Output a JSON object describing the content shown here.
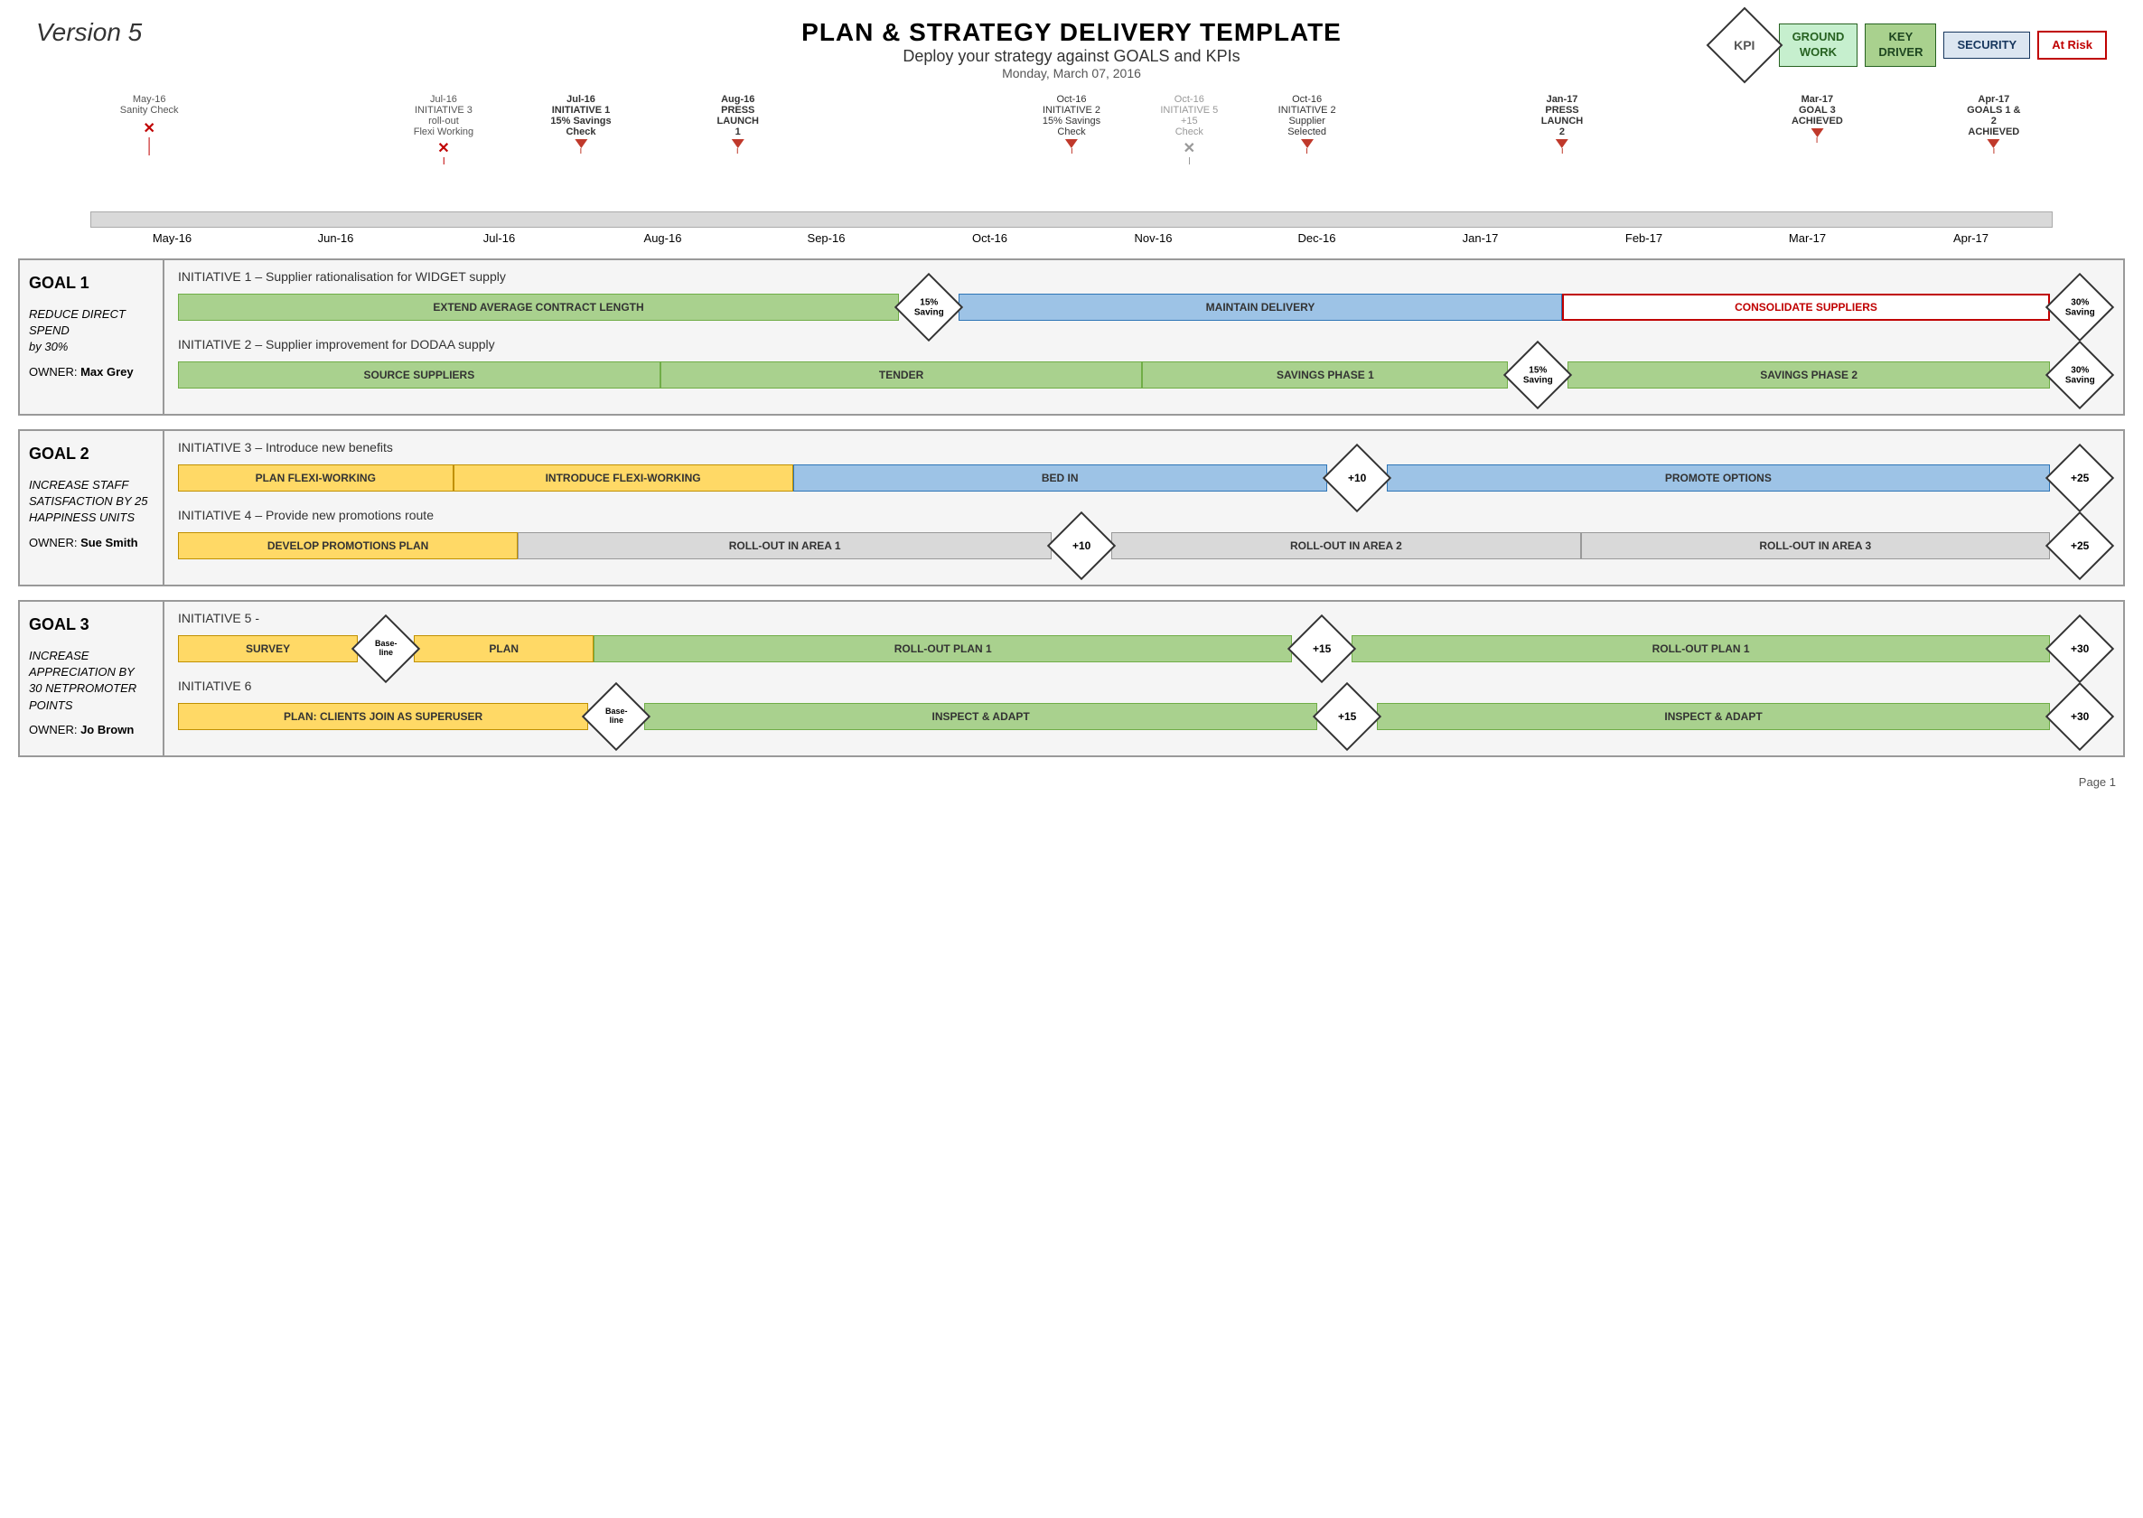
{
  "header": {
    "title": "PLAN & STRATEGY DELIVERY TEMPLATE",
    "subtitle": "Deploy your strategy against GOALS and KPIs",
    "date": "Monday, March 07, 2016",
    "version": "Version 5",
    "kpi_label": "KPI",
    "legend": [
      {
        "label": "GROUND\nWORK",
        "class": "legend-groundwork"
      },
      {
        "label": "KEY\nDRIVER",
        "class": "legend-keydriver"
      },
      {
        "label": "SECURITY",
        "class": "legend-security"
      },
      {
        "label": "At Risk",
        "class": "legend-atrisk"
      }
    ]
  },
  "timeline": {
    "months": [
      "May-16",
      "Jun-16",
      "Jul-16",
      "Aug-16",
      "Sep-16",
      "Oct-16",
      "Nov-16",
      "Dec-16",
      "Jan-17",
      "Feb-17",
      "Mar-17",
      "Apr-17"
    ],
    "events": [
      {
        "label": "May-16\nSanity Check",
        "pos_pct": 4,
        "type": "x"
      },
      {
        "label": "Jul-16\nINITIATIVE 3\nroll-out\nFlexi Working",
        "pos_pct": 19,
        "type": "x"
      },
      {
        "label": "Jul-16\nINITIATIVE 1\n15% Savings\nCheck",
        "pos_pct": 24,
        "type": "arrow",
        "bold": true
      },
      {
        "label": "Aug-16\nPRESS\nLAUNCH\n1",
        "pos_pct": 33,
        "type": "arrow",
        "bold": true
      },
      {
        "label": "Oct-16\nINITIATIVE 2\n15% Savings\nCheck",
        "pos_pct": 50,
        "type": "arrow",
        "bold": false
      },
      {
        "label": "Oct-16\nINITIATIVE 5\n+15\nCheck",
        "pos_pct": 55,
        "type": "x",
        "gray": true
      },
      {
        "label": "Oct-16\nINITIATIVE 2\nSupplier\nSelected",
        "pos_pct": 61,
        "type": "arrow"
      },
      {
        "label": "Jan-17\nPRESS\nLAUNCH\n2",
        "pos_pct": 75,
        "type": "arrow",
        "bold": true
      },
      {
        "label": "Mar-17\nGOAL 3\nACHIEVED",
        "pos_pct": 88,
        "type": "arrow",
        "bold": true
      },
      {
        "label": "Apr-17\nGOALS 1 & 2\nACHIEVED",
        "pos_pct": 97,
        "type": "arrow",
        "bold": true
      }
    ]
  },
  "goals": [
    {
      "id": "goal1",
      "title": "GOAL 1",
      "description": "REDUCE DIRECT\nSPEND\nby 30%",
      "owner_label": "OWNER:",
      "owner_name": "Max Grey",
      "initiatives": [
        {
          "title": "INITIATIVE 1 – Supplier rationalisation for WIDGET supply",
          "bars": [
            {
              "label": "EXTEND AVERAGE CONTRACT LENGTH",
              "class": "bar-green",
              "flex": 6
            },
            {
              "diamond": true,
              "label": "15%\nSaving"
            },
            {
              "label": "MAINTAIN DELIVERY",
              "class": "bar-blue",
              "flex": 5
            },
            {
              "label": "CONSOLIDATE SUPPLIERS",
              "class": "bar-red-border",
              "flex": 4
            },
            {
              "diamond": true,
              "label": "30%\nSaving"
            }
          ]
        },
        {
          "title": "INITIATIVE 2 – Supplier improvement for DODAA supply",
          "bars": [
            {
              "label": "SOURCE SUPPLIERS",
              "class": "bar-green",
              "flex": 4
            },
            {
              "label": "TENDER",
              "class": "bar-green",
              "flex": 4
            },
            {
              "label": "SAVINGS PHASE 1",
              "class": "bar-green",
              "flex": 3
            },
            {
              "diamond": true,
              "label": "15%\nSaving"
            },
            {
              "label": "SAVINGS PHASE 2",
              "class": "bar-green",
              "flex": 4
            },
            {
              "diamond": true,
              "label": "30%\nSaving"
            }
          ]
        }
      ]
    },
    {
      "id": "goal2",
      "title": "GOAL 2",
      "description": "INCREASE STAFF\nSATISFACTION BY 25\nHAPPINESS UNITS",
      "owner_label": "OWNER:",
      "owner_name": "Sue Smith",
      "initiatives": [
        {
          "title": "INITIATIVE 3 – Introduce new benefits",
          "bars": [
            {
              "label": "PLAN FLEXI-WORKING",
              "class": "bar-yellow",
              "flex": 2
            },
            {
              "label": "INTRODUCE FLEXI-WORKING",
              "class": "bar-yellow",
              "flex": 2.5
            },
            {
              "label": "BED IN",
              "class": "bar-blue",
              "flex": 4
            },
            {
              "diamond": true,
              "label": "+10"
            },
            {
              "label": "PROMOTE OPTIONS",
              "class": "bar-blue",
              "flex": 5
            },
            {
              "diamond": true,
              "label": "+25"
            }
          ]
        },
        {
          "title": "INITIATIVE 4 – Provide new promotions route",
          "bars": [
            {
              "label": "DEVELOP PROMOTIONS PLAN",
              "class": "bar-yellow",
              "flex": 2.5
            },
            {
              "label": "ROLL-OUT IN AREA 1",
              "class": "bar-lightgray",
              "flex": 4
            },
            {
              "diamond": true,
              "label": "+10"
            },
            {
              "label": "ROLL-OUT IN AREA 2",
              "class": "bar-lightgray",
              "flex": 3.5
            },
            {
              "label": "ROLL-OUT IN AREA 3",
              "class": "bar-lightgray",
              "flex": 3.5
            },
            {
              "diamond": true,
              "label": "+25"
            }
          ]
        }
      ]
    },
    {
      "id": "goal3",
      "title": "GOAL 3",
      "description": "INCREASE\nAPPRECIATION BY\n30 NETPROMOTER\nPOINTS",
      "owner_label": "OWNER:",
      "owner_name": "Jo Brown",
      "initiatives": [
        {
          "title": "INITIATIVE 5 -",
          "bars": [
            {
              "label": "SURVEY",
              "class": "bar-yellow",
              "flex": 1.2
            },
            {
              "diamond": true,
              "label": "Base-\nline",
              "small": true
            },
            {
              "label": "PLAN",
              "class": "bar-yellow",
              "flex": 1.2
            },
            {
              "label": "ROLL-OUT PLAN 1",
              "class": "bar-green",
              "flex": 5
            },
            {
              "diamond": true,
              "label": "+15"
            },
            {
              "label": "ROLL-OUT PLAN 1",
              "class": "bar-green",
              "flex": 5
            },
            {
              "diamond": true,
              "label": "+30"
            }
          ]
        },
        {
          "title": "INITIATIVE 6",
          "bars": [
            {
              "label": "PLAN: CLIENTS JOIN AS SUPERUSER",
              "class": "bar-yellow",
              "flex": 3
            },
            {
              "diamond": true,
              "label": "Base-\nline",
              "small": true
            },
            {
              "label": "INSPECT & ADAPT",
              "class": "bar-green",
              "flex": 5
            },
            {
              "diamond": true,
              "label": "+15"
            },
            {
              "label": "INSPECT & ADAPT",
              "class": "bar-green",
              "flex": 5
            },
            {
              "diamond": true,
              "label": "+30"
            }
          ]
        }
      ]
    }
  ],
  "page_number": "Page 1"
}
